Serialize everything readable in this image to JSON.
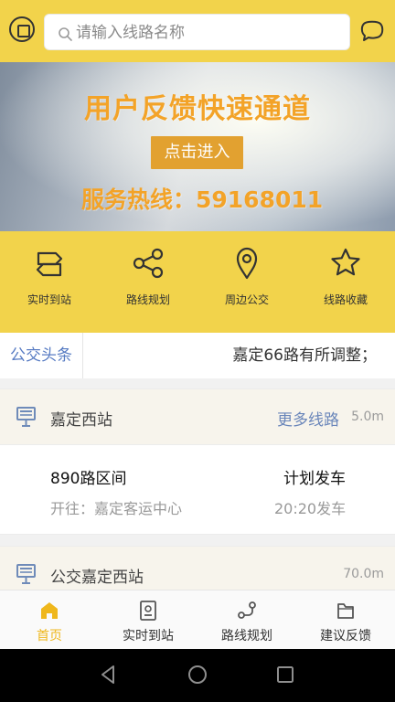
{
  "header": {
    "logo": "bus-company-logo-icon",
    "search_placeholder": "请输入线路名称",
    "chat_icon": "chat-bubble-icon"
  },
  "banner": {
    "title": "用户反馈快速通道",
    "button_label": "点击进入",
    "hotline": "服务热线：59168011",
    "accent_color": "#f3a328"
  },
  "quick_actions": [
    {
      "label": "实时到站",
      "icon": "route-arrows-icon"
    },
    {
      "label": "路线规划",
      "icon": "route-share-icon"
    },
    {
      "label": "周边公交",
      "icon": "location-pin-icon"
    },
    {
      "label": "线路收藏",
      "icon": "star-icon"
    }
  ],
  "news": {
    "label": "公交头条",
    "text": "嘉定66路有所调整；"
  },
  "stations": [
    {
      "name": "嘉定西站",
      "more_label": "更多线路",
      "distance": "5.0m",
      "routes": [
        {
          "name": "890路区间",
          "destination": "开往：嘉定客运中心",
          "status": "计划发车",
          "time": "20:20发车"
        }
      ]
    },
    {
      "name": "公交嘉定西站",
      "distance": "70.0m"
    }
  ],
  "tabbar": [
    {
      "label": "首页",
      "icon": "home-icon",
      "active": true
    },
    {
      "label": "实时到站",
      "icon": "realtime-arrival-icon",
      "active": false
    },
    {
      "label": "路线规划",
      "icon": "route-planning-icon",
      "active": false
    },
    {
      "label": "建议反馈",
      "icon": "feedback-folder-icon",
      "active": false
    }
  ],
  "android_nav": {
    "back_icon": "back-triangle-icon",
    "home_icon": "home-circle-icon",
    "recent_icon": "recent-square-icon"
  },
  "colors": {
    "brand_yellow": "#f2d34b",
    "link_blue": "#587cc3",
    "active_tab": "#efb71c"
  }
}
